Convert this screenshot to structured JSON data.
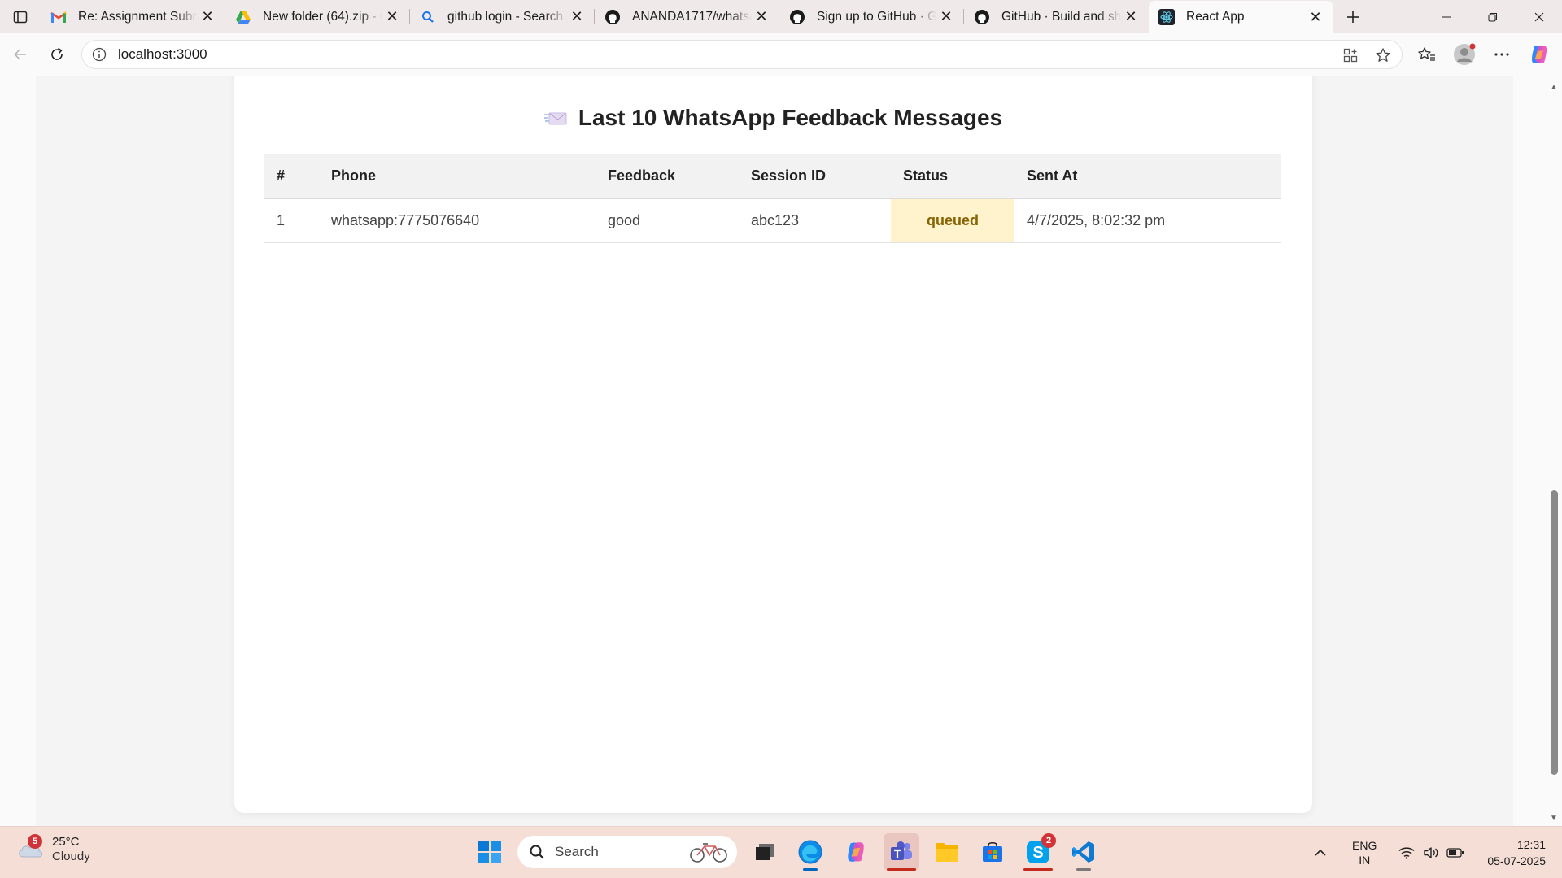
{
  "browser": {
    "tabs": [
      {
        "title": "Re: Assignment Submis",
        "icon": "gmail-icon"
      },
      {
        "title": "New folder (64).zip - G",
        "icon": "google-drive-icon"
      },
      {
        "title": "github login - Search",
        "icon": "search-icon"
      },
      {
        "title": "ANANDA1717/whatsap",
        "icon": "github-icon"
      },
      {
        "title": "Sign up to GitHub · Git",
        "icon": "github-icon"
      },
      {
        "title": "GitHub · Build and ship",
        "icon": "github-icon"
      },
      {
        "title": "React App",
        "icon": "react-icon",
        "active": true
      }
    ],
    "url": "localhost:3000"
  },
  "page": {
    "heading": "Last 10 WhatsApp Feedback Messages",
    "table": {
      "headers": [
        "#",
        "Phone",
        "Feedback",
        "Session ID",
        "Status",
        "Sent At"
      ],
      "rows": [
        [
          "1",
          "whatsapp:7775076640",
          "good",
          "abc123",
          "queued",
          "4/7/2025, 8:02:32 pm"
        ]
      ]
    },
    "status_colors": {
      "queued_bg": "#fff3cd",
      "queued_text": "#856404"
    }
  },
  "taskbar": {
    "weather": {
      "temp": "25°C",
      "desc": "Cloudy",
      "badge": "5"
    },
    "search_placeholder": "Search",
    "skype_badge": "2",
    "lang": {
      "line1": "ENG",
      "line2": "IN"
    },
    "clock": {
      "time": "12:31",
      "date": "05-07-2025"
    }
  }
}
